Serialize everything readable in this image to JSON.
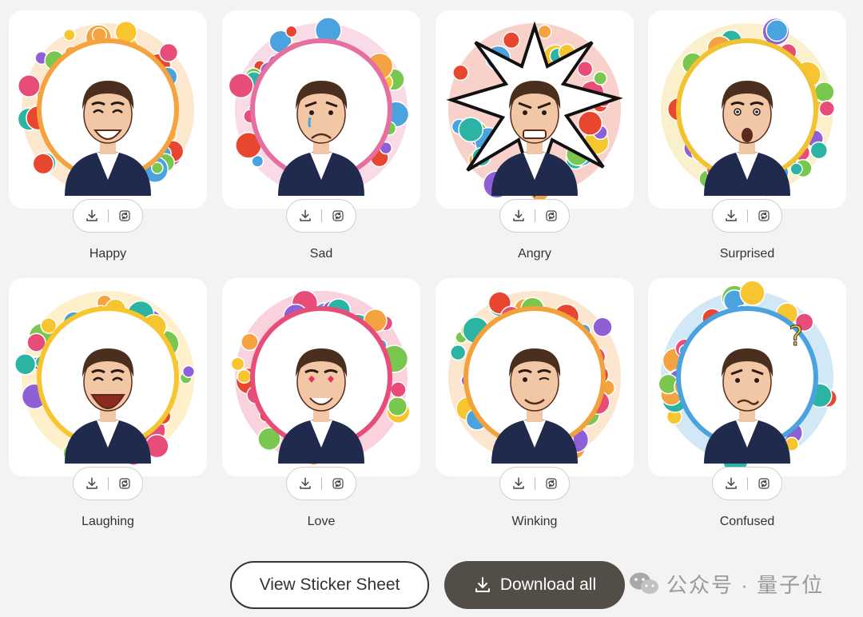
{
  "stickers": [
    {
      "label": "Happy",
      "download_icon": "download-icon",
      "regen_icon": "refresh-icon",
      "bg": "#f4a340",
      "mood": "happy"
    },
    {
      "label": "Sad",
      "download_icon": "download-icon",
      "regen_icon": "refresh-icon",
      "bg": "#e56fa0",
      "mood": "sad"
    },
    {
      "label": "Angry",
      "download_icon": "download-icon",
      "regen_icon": "refresh-icon",
      "bg": "#e8462e",
      "mood": "angry"
    },
    {
      "label": "Surprised",
      "download_icon": "download-icon",
      "regen_icon": "refresh-icon",
      "bg": "#f1c232",
      "mood": "surprised"
    },
    {
      "label": "Laughing",
      "download_icon": "download-icon",
      "regen_icon": "refresh-icon",
      "bg": "#f7c530",
      "mood": "laughing"
    },
    {
      "label": "Love",
      "download_icon": "download-icon",
      "regen_icon": "refresh-icon",
      "bg": "#e84c78",
      "mood": "love"
    },
    {
      "label": "Winking",
      "download_icon": "download-icon",
      "regen_icon": "refresh-icon",
      "bg": "#f3a13b",
      "mood": "winking"
    },
    {
      "label": "Confused",
      "download_icon": "download-icon",
      "regen_icon": "refresh-icon",
      "bg": "#4aa3df",
      "mood": "confused"
    }
  ],
  "footer": {
    "view_sheet_label": "View Sticker Sheet",
    "download_all_label": "Download all",
    "download_all_icon": "download-icon"
  },
  "watermark": {
    "text": "公众号 · 量子位",
    "icon": "wechat-icon"
  },
  "colors": {
    "page_bg": "#f3f3f3",
    "primary_button": "#534d48",
    "suit": "#1f2a4d",
    "skin": "#f2c7a5",
    "hair": "#4a2f1e"
  }
}
